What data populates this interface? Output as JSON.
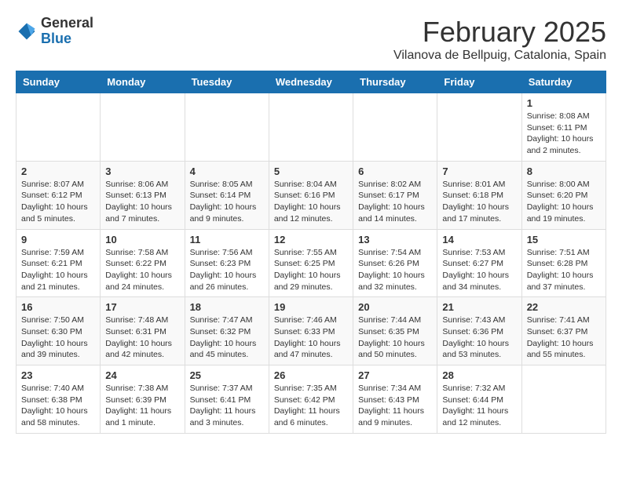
{
  "logo": {
    "general": "General",
    "blue": "Blue"
  },
  "title": {
    "month": "February 2025",
    "location": "Vilanova de Bellpuig, Catalonia, Spain"
  },
  "headers": [
    "Sunday",
    "Monday",
    "Tuesday",
    "Wednesday",
    "Thursday",
    "Friday",
    "Saturday"
  ],
  "weeks": [
    [
      {
        "day": "",
        "info": ""
      },
      {
        "day": "",
        "info": ""
      },
      {
        "day": "",
        "info": ""
      },
      {
        "day": "",
        "info": ""
      },
      {
        "day": "",
        "info": ""
      },
      {
        "day": "",
        "info": ""
      },
      {
        "day": "1",
        "info": "Sunrise: 8:08 AM\nSunset: 6:11 PM\nDaylight: 10 hours and 2 minutes."
      }
    ],
    [
      {
        "day": "2",
        "info": "Sunrise: 8:07 AM\nSunset: 6:12 PM\nDaylight: 10 hours and 5 minutes."
      },
      {
        "day": "3",
        "info": "Sunrise: 8:06 AM\nSunset: 6:13 PM\nDaylight: 10 hours and 7 minutes."
      },
      {
        "day": "4",
        "info": "Sunrise: 8:05 AM\nSunset: 6:14 PM\nDaylight: 10 hours and 9 minutes."
      },
      {
        "day": "5",
        "info": "Sunrise: 8:04 AM\nSunset: 6:16 PM\nDaylight: 10 hours and 12 minutes."
      },
      {
        "day": "6",
        "info": "Sunrise: 8:02 AM\nSunset: 6:17 PM\nDaylight: 10 hours and 14 minutes."
      },
      {
        "day": "7",
        "info": "Sunrise: 8:01 AM\nSunset: 6:18 PM\nDaylight: 10 hours and 17 minutes."
      },
      {
        "day": "8",
        "info": "Sunrise: 8:00 AM\nSunset: 6:20 PM\nDaylight: 10 hours and 19 minutes."
      }
    ],
    [
      {
        "day": "9",
        "info": "Sunrise: 7:59 AM\nSunset: 6:21 PM\nDaylight: 10 hours and 21 minutes."
      },
      {
        "day": "10",
        "info": "Sunrise: 7:58 AM\nSunset: 6:22 PM\nDaylight: 10 hours and 24 minutes."
      },
      {
        "day": "11",
        "info": "Sunrise: 7:56 AM\nSunset: 6:23 PM\nDaylight: 10 hours and 26 minutes."
      },
      {
        "day": "12",
        "info": "Sunrise: 7:55 AM\nSunset: 6:25 PM\nDaylight: 10 hours and 29 minutes."
      },
      {
        "day": "13",
        "info": "Sunrise: 7:54 AM\nSunset: 6:26 PM\nDaylight: 10 hours and 32 minutes."
      },
      {
        "day": "14",
        "info": "Sunrise: 7:53 AM\nSunset: 6:27 PM\nDaylight: 10 hours and 34 minutes."
      },
      {
        "day": "15",
        "info": "Sunrise: 7:51 AM\nSunset: 6:28 PM\nDaylight: 10 hours and 37 minutes."
      }
    ],
    [
      {
        "day": "16",
        "info": "Sunrise: 7:50 AM\nSunset: 6:30 PM\nDaylight: 10 hours and 39 minutes."
      },
      {
        "day": "17",
        "info": "Sunrise: 7:48 AM\nSunset: 6:31 PM\nDaylight: 10 hours and 42 minutes."
      },
      {
        "day": "18",
        "info": "Sunrise: 7:47 AM\nSunset: 6:32 PM\nDaylight: 10 hours and 45 minutes."
      },
      {
        "day": "19",
        "info": "Sunrise: 7:46 AM\nSunset: 6:33 PM\nDaylight: 10 hours and 47 minutes."
      },
      {
        "day": "20",
        "info": "Sunrise: 7:44 AM\nSunset: 6:35 PM\nDaylight: 10 hours and 50 minutes."
      },
      {
        "day": "21",
        "info": "Sunrise: 7:43 AM\nSunset: 6:36 PM\nDaylight: 10 hours and 53 minutes."
      },
      {
        "day": "22",
        "info": "Sunrise: 7:41 AM\nSunset: 6:37 PM\nDaylight: 10 hours and 55 minutes."
      }
    ],
    [
      {
        "day": "23",
        "info": "Sunrise: 7:40 AM\nSunset: 6:38 PM\nDaylight: 10 hours and 58 minutes."
      },
      {
        "day": "24",
        "info": "Sunrise: 7:38 AM\nSunset: 6:39 PM\nDaylight: 11 hours and 1 minute."
      },
      {
        "day": "25",
        "info": "Sunrise: 7:37 AM\nSunset: 6:41 PM\nDaylight: 11 hours and 3 minutes."
      },
      {
        "day": "26",
        "info": "Sunrise: 7:35 AM\nSunset: 6:42 PM\nDaylight: 11 hours and 6 minutes."
      },
      {
        "day": "27",
        "info": "Sunrise: 7:34 AM\nSunset: 6:43 PM\nDaylight: 11 hours and 9 minutes."
      },
      {
        "day": "28",
        "info": "Sunrise: 7:32 AM\nSunset: 6:44 PM\nDaylight: 11 hours and 12 minutes."
      },
      {
        "day": "",
        "info": ""
      }
    ]
  ]
}
